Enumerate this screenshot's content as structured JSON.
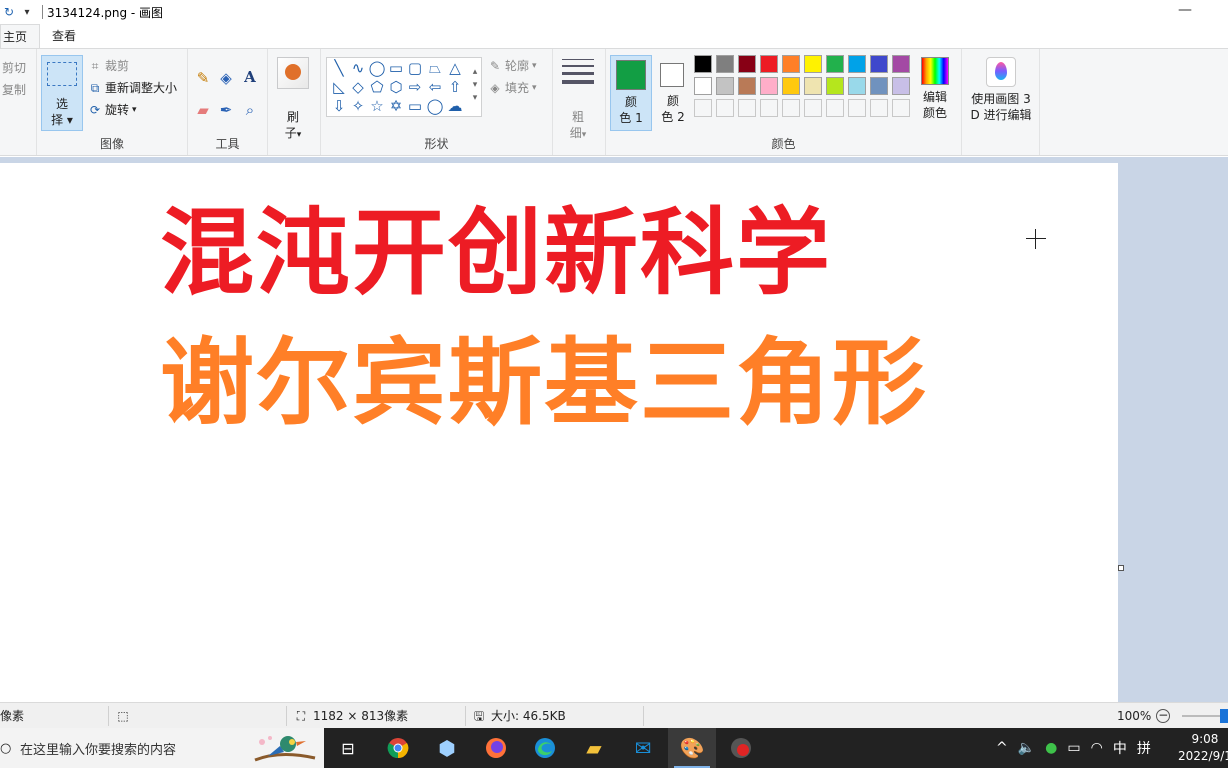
{
  "window": {
    "title": "3134124.png - 画图",
    "quick_access": [
      "redo-icon",
      "dropdown-icon"
    ]
  },
  "tabs": [
    {
      "label": "主页",
      "active": true
    },
    {
      "label": "查看",
      "active": false
    }
  ],
  "ribbon": {
    "clipboard": {
      "cut": "剪切",
      "copy": "复制"
    },
    "image": {
      "group_label": "图像",
      "select": "选\n择",
      "crop": "裁剪",
      "resize": "重新调整大小",
      "rotate": "旋转"
    },
    "tools": {
      "group_label": "工具"
    },
    "brush": {
      "label": "刷\n子"
    },
    "shapes": {
      "group_label": "形状",
      "outline": "轮廓",
      "fill": "填充"
    },
    "size": {
      "label": "粗\n细"
    },
    "colors": {
      "group_label": "颜色",
      "color1_label": "颜\n色 1",
      "color2_label": "颜\n色 2",
      "color1": "#129e44",
      "color2": "#ffffff",
      "edit_colors": "编辑\n颜色",
      "palette_row1": [
        "#000000",
        "#7f7f7f",
        "#880015",
        "#ed1c24",
        "#ff7f27",
        "#fff200",
        "#22b14c",
        "#00a2e8",
        "#3f48cc",
        "#a349a4"
      ],
      "palette_row2": [
        "#ffffff",
        "#c3c3c3",
        "#b97a57",
        "#ffaec9",
        "#ffc90e",
        "#efe4b0",
        "#b5e61d",
        "#99d9ea",
        "#7092be",
        "#c8bfe7"
      ]
    },
    "paint3d": {
      "label": "使用画图 3\nD 进行编辑"
    }
  },
  "canvas": {
    "line1": "混沌开创新科学",
    "line2": "谢尔宾斯基三角形",
    "line1_color": "#ed1c24",
    "line2_color": "#ff7f27"
  },
  "status": {
    "pos": "像素",
    "canvas_size": "1182 × 813像素",
    "file_size": "大小: 46.5KB",
    "zoom": "100%"
  },
  "taskbar": {
    "search_placeholder": "在这里输入你要搜索的内容",
    "tray_ime": "中",
    "tray_layout": "拼",
    "time": "9:08",
    "date": "2022/9/1"
  }
}
